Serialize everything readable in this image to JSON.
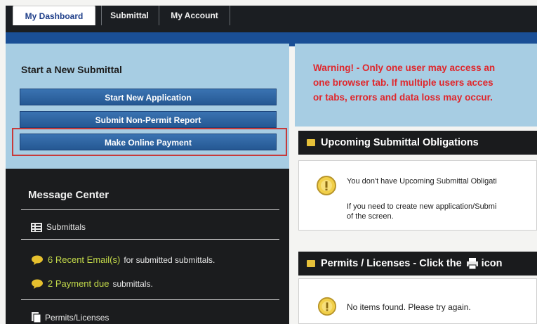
{
  "tabs": [
    {
      "label": "My Dashboard"
    },
    {
      "label": "Submittal"
    },
    {
      "label": "My Account"
    }
  ],
  "start": {
    "title": "Start a New Submittal",
    "buttons": [
      {
        "label": "Start New Application"
      },
      {
        "label": "Submit Non-Permit Report"
      },
      {
        "label": "Make Online Payment"
      }
    ]
  },
  "message_center": {
    "title": "Message Center",
    "submittals_label": "Submittals",
    "recent_email_link": "6 Recent Email(s)",
    "recent_email_text": "for submitted submittals.",
    "payment_link": "2 Payment due",
    "payment_text": "submittals.",
    "permits_label": "Permits/Licenses"
  },
  "warning": {
    "line1": "Warning! - Only one user may access an",
    "line2": "one browser tab. If multiple users acces",
    "line3": "or tabs, errors and data loss may occur."
  },
  "upcoming": {
    "title": "Upcoming Submittal Obligations",
    "message": "You don't have Upcoming Submittal Obligati",
    "hint_line1": "If you need to create new application/Submi",
    "hint_line2": "of the screen."
  },
  "permits": {
    "title": "Permits / Licenses - Click the",
    "title_suffix": "icon",
    "message": "No items found. Please try again."
  },
  "colors": {
    "accent_blue": "#255893",
    "warning_red": "#e0262b",
    "link_green": "#c3d94a",
    "highlight_border": "#c73a3a"
  }
}
